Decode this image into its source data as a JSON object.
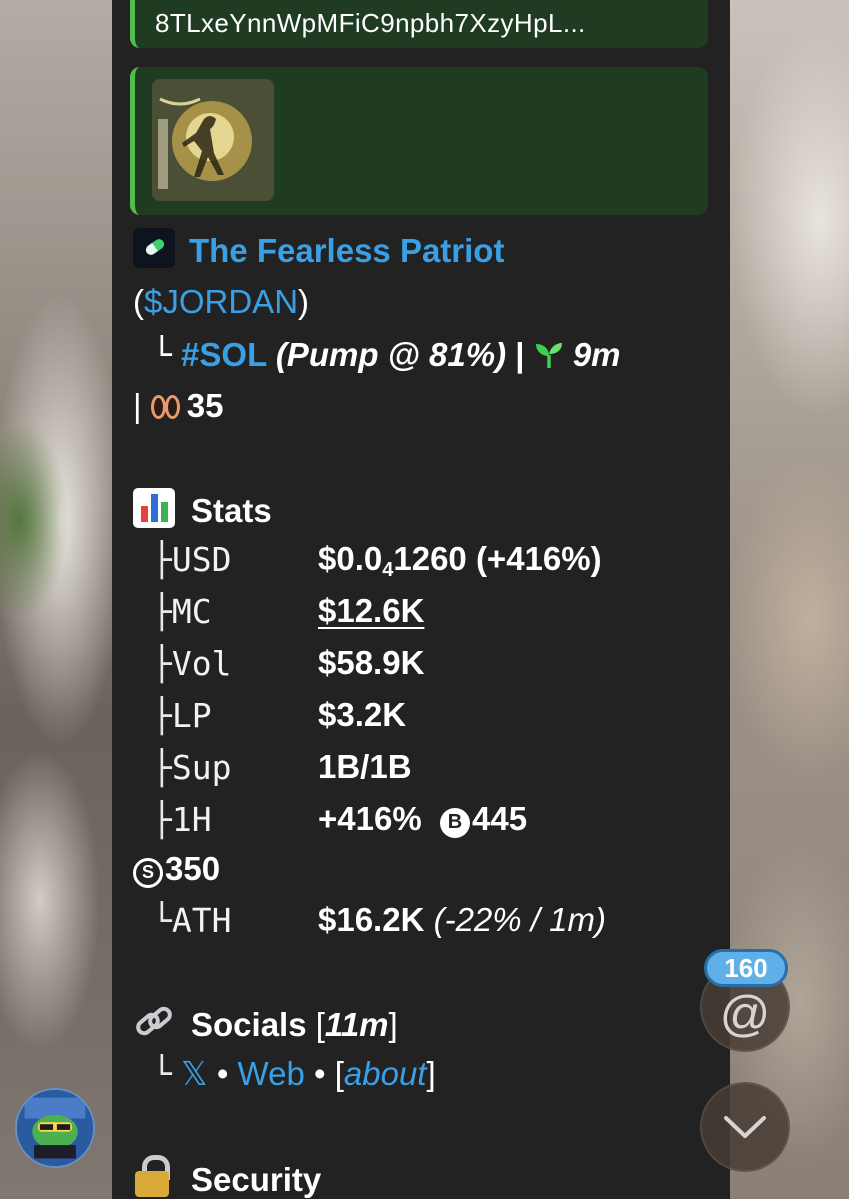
{
  "reply": {
    "address": "8TLxeYnnWpMFiC9npbh7XzyHpL..."
  },
  "token": {
    "name": "The Fearless Patriot",
    "ticker_open": "(",
    "ticker": "$JORDAN",
    "ticker_close": ")",
    "tree_branch": "└",
    "chain_tag": "#SOL",
    "pump_prefix": "(Pump @ ",
    "pump_percent": "81%",
    "pump_suffix": ")",
    "separator": "|",
    "age": "9m",
    "separator2": "|",
    "holders": "35"
  },
  "stats": {
    "title": "Stats",
    "rows": [
      {
        "tree": "├",
        "key": "USD",
        "value_main": "$0.0",
        "value_sub": "4",
        "value_rest": "1260 (+416%)"
      },
      {
        "tree": "├",
        "key": "MC",
        "value": "$12.6K"
      },
      {
        "tree": "├",
        "key": "Vol",
        "value": "$58.9K"
      },
      {
        "tree": "├",
        "key": "LP",
        "value": "$3.2K"
      },
      {
        "tree": "├",
        "key": "Sup",
        "value": "1B/1B"
      },
      {
        "tree": "├",
        "key": "1H",
        "value": "+416%",
        "buys_icon": "B",
        "buys": "445",
        "sells_icon": "S",
        "sells": "350"
      },
      {
        "tree": "└",
        "key": "ATH",
        "value": "$16.2K",
        "value_italic": "(-22% / 1m)"
      }
    ]
  },
  "socials": {
    "title": "Socials",
    "age_open": "[",
    "age": "11m",
    "age_close": "]",
    "tree": "└",
    "x_label": "𝕏",
    "dot": "•",
    "web_label": "Web",
    "dot2": "•",
    "about_open": "[",
    "about_label": "about",
    "about_close": "]"
  },
  "security": {
    "title": "Security"
  },
  "floating": {
    "mention_count": "160",
    "mention_symbol": "@"
  },
  "icons": {
    "token": "pill-icon",
    "age": "seedling-icon",
    "holders": "eyes-icon",
    "stats": "bar-chart-icon",
    "socials": "link-icon",
    "security": "lock-icon",
    "scroll": "chevron-down-icon"
  },
  "colors": {
    "panel": "#222222",
    "quote_bar": "#4fbf4a",
    "quote_bg": "#1f3b22",
    "link": "#3aa0e6",
    "badge": "#5fb0e8"
  }
}
